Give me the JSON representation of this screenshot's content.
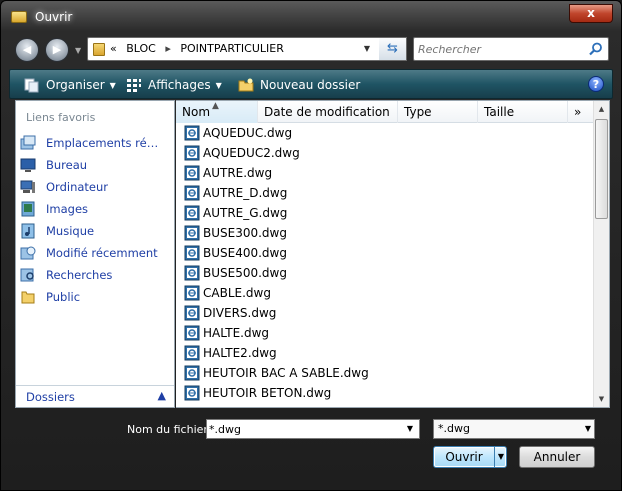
{
  "window": {
    "title": "Ouvrir",
    "close_glyph": "x"
  },
  "address": {
    "prefix": "«",
    "crumbs": [
      "BLOC",
      "POINTPARTICULIER"
    ],
    "separator": "▸"
  },
  "search": {
    "placeholder": "Rechercher"
  },
  "toolbar": {
    "organize_label": "Organiser",
    "views_label": "Affichages",
    "new_folder_label": "Nouveau dossier",
    "help_glyph": "?"
  },
  "sidebar": {
    "header": "Liens favoris",
    "items": [
      {
        "label": "Emplacements réce...",
        "icon": "recent-places-icon"
      },
      {
        "label": "Bureau",
        "icon": "desktop-icon"
      },
      {
        "label": "Ordinateur",
        "icon": "computer-icon"
      },
      {
        "label": "Images",
        "icon": "pictures-icon"
      },
      {
        "label": "Musique",
        "icon": "music-icon"
      },
      {
        "label": "Modifié récemment",
        "icon": "recently-changed-icon"
      },
      {
        "label": "Recherches",
        "icon": "searches-icon"
      },
      {
        "label": "Public",
        "icon": "public-folder-icon"
      }
    ],
    "folders_label": "Dossiers"
  },
  "filelist": {
    "columns": [
      "Nom",
      "Date de modification",
      "Type",
      "Taille"
    ],
    "more_columns_glyph": "»",
    "files": [
      "AQUEDUC.dwg",
      "AQUEDUC2.dwg",
      "AUTRE.dwg",
      "AUTRE_D.dwg",
      "AUTRE_G.dwg",
      "BUSE300.dwg",
      "BUSE400.dwg",
      "BUSE500.dwg",
      "CABLE.dwg",
      "DIVERS.dwg",
      "HALTE.dwg",
      "HALTE2.dwg",
      "HEUTOIR BAC A SABLE.dwg",
      "HEUTOIR BETON.dwg"
    ]
  },
  "bottom": {
    "filename_label": "Nom du fichier :",
    "filename_value": "*.dwg",
    "filter_value": "*.dwg",
    "open_label": "Ouvrir",
    "cancel_label": "Annuler"
  },
  "colors": {
    "toolbar": "#1f5464",
    "link": "#1f3fa5",
    "window_frame": "#1e1e1e"
  }
}
